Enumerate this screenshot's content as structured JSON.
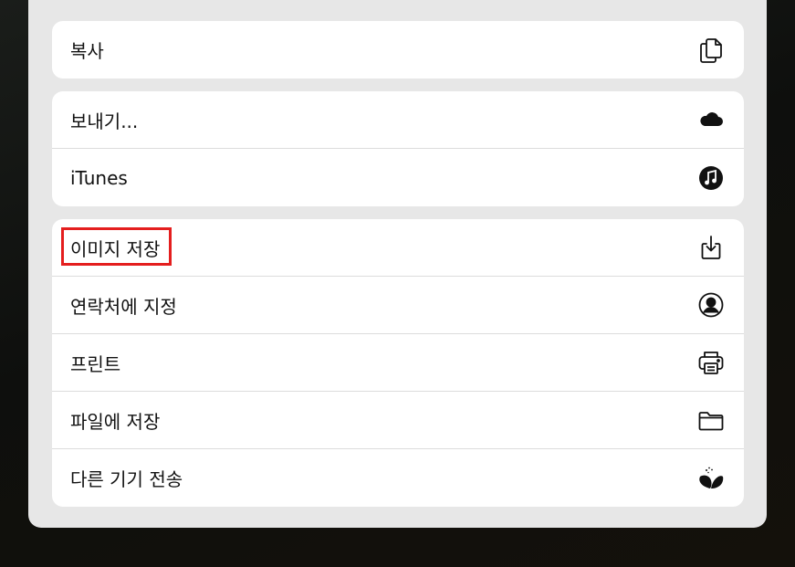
{
  "groups": [
    {
      "items": [
        {
          "label": "복사",
          "icon": "copy-icon"
        }
      ]
    },
    {
      "items": [
        {
          "label": "보내기...",
          "icon": "cloud-icon"
        },
        {
          "label": "iTunes",
          "icon": "music-note-icon"
        }
      ]
    },
    {
      "items": [
        {
          "label": "이미지 저장",
          "icon": "save-download-icon"
        },
        {
          "label": "연락처에 지정",
          "icon": "person-circle-icon"
        },
        {
          "label": "프린트",
          "icon": "printer-icon"
        },
        {
          "label": "파일에 저장",
          "icon": "folder-icon"
        },
        {
          "label": "다른 기기 전송",
          "icon": "sprout-leaf-icon"
        }
      ]
    }
  ],
  "colors": {
    "highlight": "#e41e1e",
    "sheet_bg": "#e7e7e7",
    "row_bg": "#ffffff"
  }
}
